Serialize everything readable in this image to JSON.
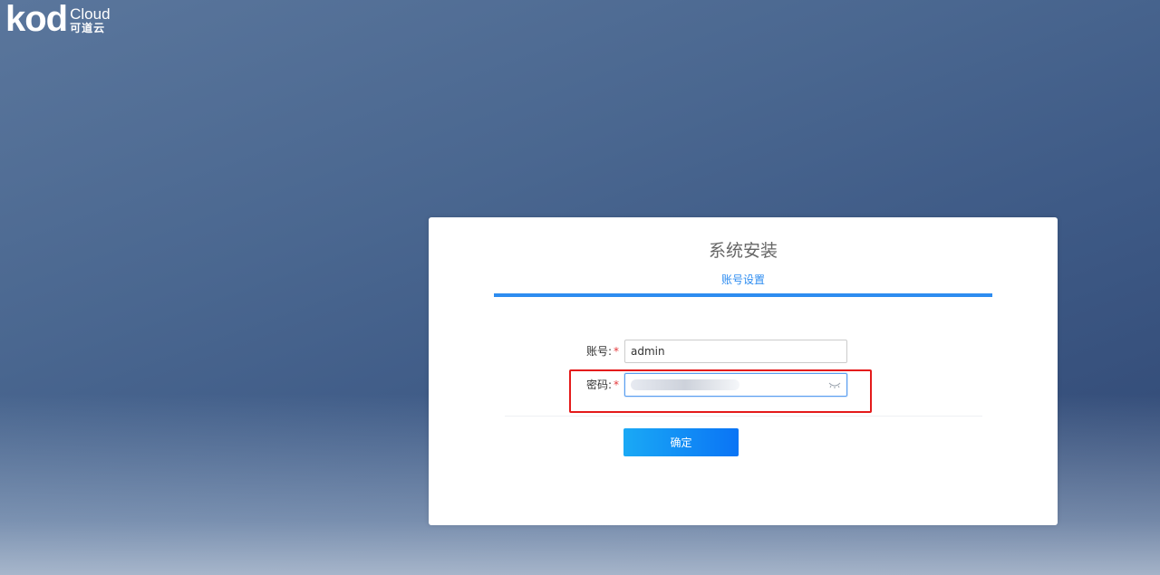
{
  "logo": {
    "mark": "kod",
    "cloud": "Cloud",
    "cn": "可道云"
  },
  "panel": {
    "title": "系统安装",
    "step": "账号设置",
    "fields": [
      {
        "label": "账号",
        "separator": ":",
        "required": "*",
        "value": "admin"
      },
      {
        "label": "密码",
        "separator": ":",
        "required": "*",
        "value": ""
      }
    ],
    "submit_label": "确定"
  },
  "colors": {
    "accent": "#2d8cf0",
    "highlight": "#e41b1b",
    "required": "#e4393c"
  }
}
